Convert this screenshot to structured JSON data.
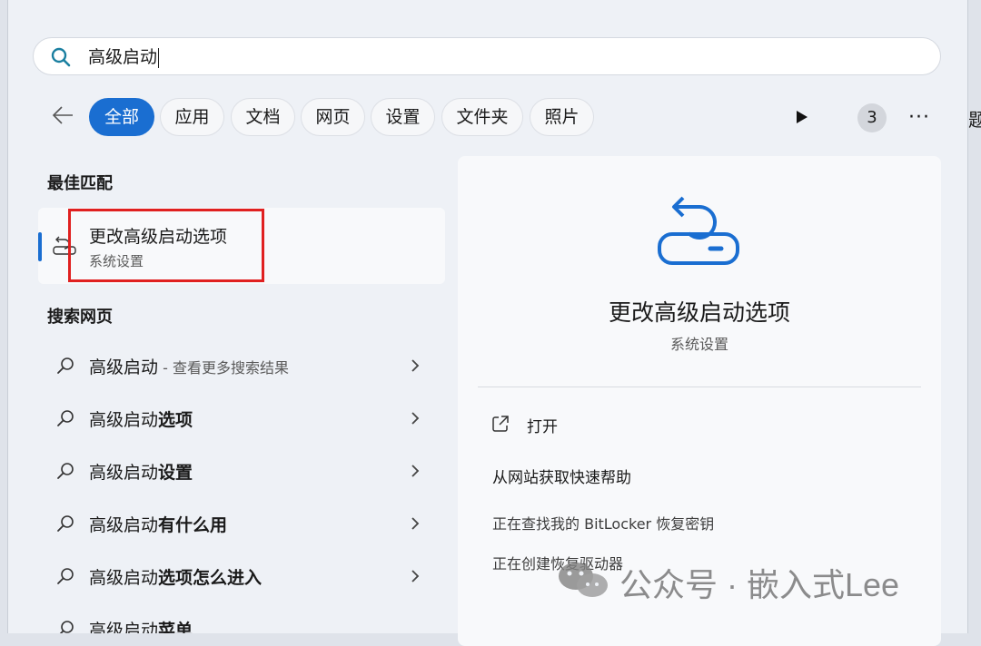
{
  "search": {
    "query": "高级启动"
  },
  "filters": [
    {
      "label": "全部",
      "active": true
    },
    {
      "label": "应用",
      "active": false
    },
    {
      "label": "文档",
      "active": false
    },
    {
      "label": "网页",
      "active": false
    },
    {
      "label": "设置",
      "active": false
    },
    {
      "label": "文件夹",
      "active": false
    },
    {
      "label": "照片",
      "active": false
    }
  ],
  "toolbar": {
    "count": "3",
    "more": "···",
    "clipped_text": "题"
  },
  "best_match": {
    "section_title": "最佳匹配",
    "title": "更改高级启动选项",
    "subtitle": "系统设置"
  },
  "web_search": {
    "section_title": "搜索网页",
    "items": [
      {
        "prefix": "高级启动",
        "bold": "",
        "hint": " - 查看更多搜索结果"
      },
      {
        "prefix": "高级启动",
        "bold": "选项",
        "hint": ""
      },
      {
        "prefix": "高级启动",
        "bold": "设置",
        "hint": ""
      },
      {
        "prefix": "高级启动",
        "bold": "有什么用",
        "hint": ""
      },
      {
        "prefix": "高级启动",
        "bold": "选项怎么进入",
        "hint": ""
      },
      {
        "prefix": "高级启动",
        "bold": "菜单",
        "hint": ""
      }
    ]
  },
  "detail": {
    "title": "更改高级启动选项",
    "subtitle": "系统设置",
    "open_label": "打开",
    "help_label": "从网站获取快速帮助",
    "links": [
      "正在查找我的 BitLocker 恢复密钥",
      "正在创建恢复驱动器"
    ]
  },
  "watermark": {
    "text": "公众号 · 嵌入式Lee"
  },
  "colors": {
    "accent": "#1a6ed1",
    "highlight": "#e02020",
    "panel_bg": "#eef1f6"
  }
}
